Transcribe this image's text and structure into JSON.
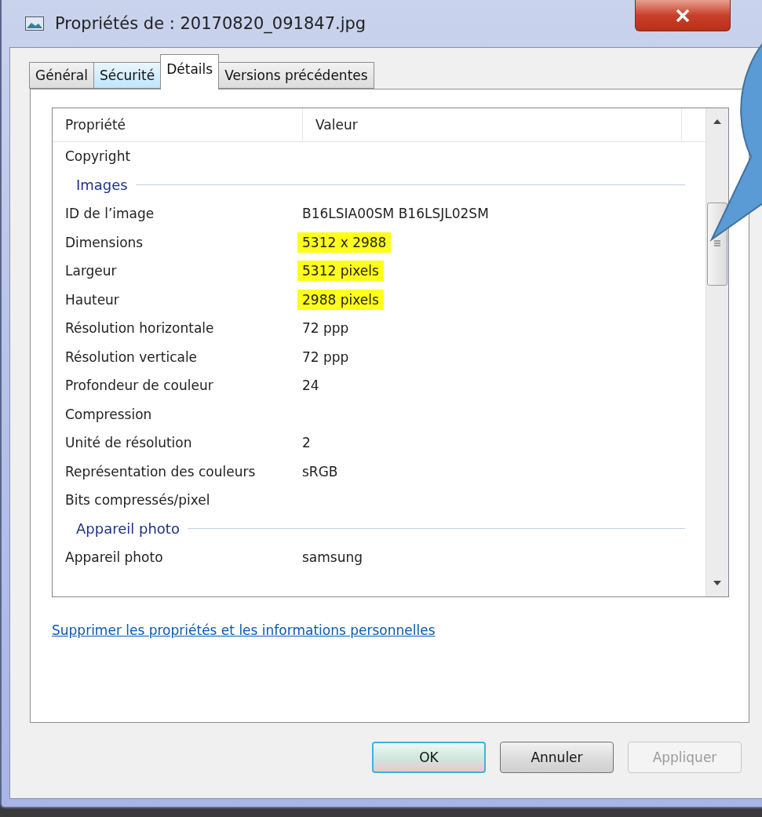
{
  "window": {
    "title": "Propriétés de : 20170820_091847.jpg"
  },
  "tabs": [
    {
      "label": "Général",
      "selected": false,
      "hovered": false
    },
    {
      "label": "Sécurité",
      "selected": false,
      "hovered": true
    },
    {
      "label": "Détails",
      "selected": true,
      "hovered": false
    },
    {
      "label": "Versions précédentes",
      "selected": false,
      "hovered": false
    }
  ],
  "list": {
    "columns": [
      "Propriété",
      "Valeur"
    ],
    "rows": [
      {
        "kind": "property",
        "name": "Copyright"
      },
      {
        "kind": "group",
        "name": "Images"
      },
      {
        "kind": "property",
        "name": "ID de l’image",
        "value": "B16LSIA00SM B16LSJL02SM",
        "highlighted": false
      },
      {
        "kind": "property",
        "name": "Dimensions",
        "value": "5312 x 2988",
        "highlighted": true
      },
      {
        "kind": "property",
        "name": "Largeur",
        "value": "5312 pixels",
        "highlighted": true
      },
      {
        "kind": "property",
        "name": "Hauteur",
        "value": "2988 pixels",
        "highlighted": true
      },
      {
        "kind": "property",
        "name": "Résolution horizontale",
        "value": "72 ppp",
        "highlighted": false
      },
      {
        "kind": "property",
        "name": "Résolution verticale",
        "value": "72 ppp",
        "highlighted": false
      },
      {
        "kind": "property",
        "name": "Profondeur de couleur",
        "value": "24",
        "highlighted": false
      },
      {
        "kind": "property",
        "name": "Compression"
      },
      {
        "kind": "property",
        "name": "Unité de résolution",
        "value": "2",
        "highlighted": false
      },
      {
        "kind": "property",
        "name": "Représentation des couleurs",
        "value": "sRGB",
        "highlighted": false
      },
      {
        "kind": "property",
        "name": "Bits compressés/pixel"
      },
      {
        "kind": "group",
        "name": "Appareil photo"
      },
      {
        "kind": "property",
        "name": "Appareil photo",
        "value": "samsung",
        "highlighted": false
      }
    ]
  },
  "link": "Supprimer les propriétés et les informations personnelles",
  "buttons": [
    {
      "label": "OK",
      "default": true,
      "disabled": false
    },
    {
      "label": "Annuler",
      "default": false,
      "disabled": false
    },
    {
      "label": "Appliquer",
      "default": false,
      "disabled": true
    }
  ]
}
